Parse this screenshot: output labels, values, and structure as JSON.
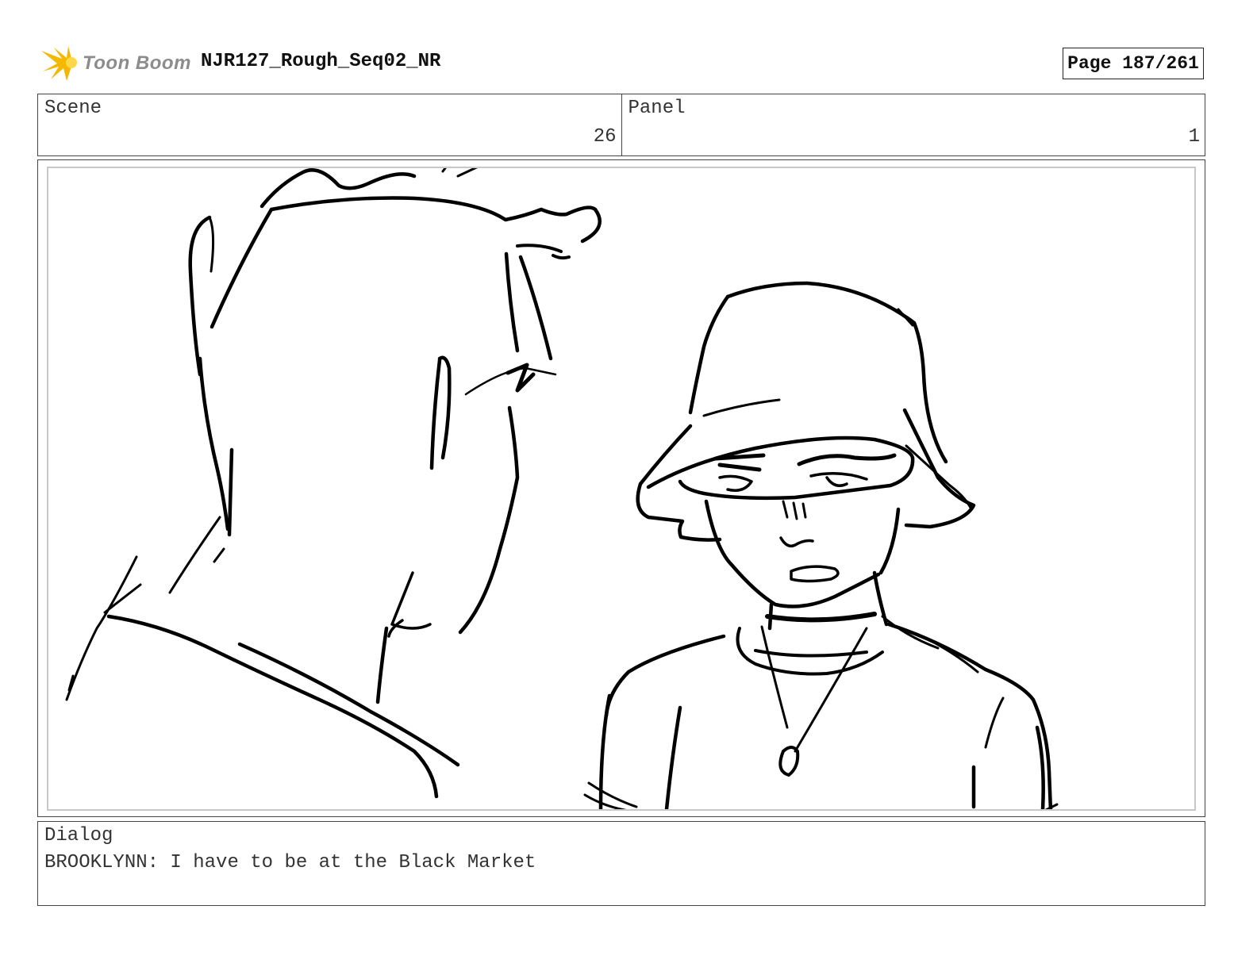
{
  "header": {
    "logo_text": "Toon Boom",
    "logo_icon": "toon-boom-starburst-icon",
    "project_title": "NJR127_Rough_Seq02_NR",
    "page_label": "Page 187/261"
  },
  "info": {
    "scene_label": "Scene",
    "scene_value": "26",
    "panel_label": "Panel",
    "panel_value": "1"
  },
  "dialog": {
    "label": "Dialog",
    "text": "BROOKLYNN: I have to be at the Black Market"
  },
  "colors": {
    "logo_accent": "#f5b800",
    "logo_text": "#8c8c8c",
    "sketch_ink": "#000000",
    "frame_border": "#444444"
  }
}
